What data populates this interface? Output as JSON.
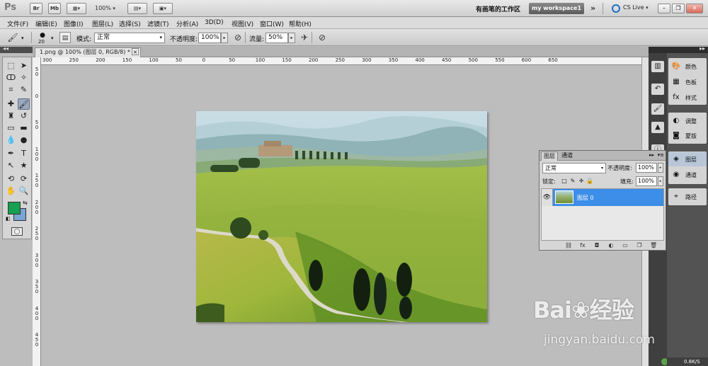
{
  "app": {
    "bridge_label": "Br",
    "minibridge_label": "Mb",
    "zoom": "100%",
    "workspace_title": "有画笔的工作区",
    "workspace_button": "my workspace1",
    "cs_live": "CS Live"
  },
  "menu": [
    "文件(F)",
    "编辑(E)",
    "图像(I)",
    "图层(L)",
    "选择(S)",
    "滤镜(T)",
    "分析(A)",
    "3D(D)",
    "视图(V)",
    "窗口(W)",
    "帮助(H)"
  ],
  "options": {
    "brush_size": "20",
    "mode_label": "模式:",
    "mode_value": "正常",
    "opacity_label": "不透明度:",
    "opacity_value": "100%",
    "flow_label": "流量:",
    "flow_value": "50%"
  },
  "document": {
    "tab_title": "1.png @ 100% (图层 0, RGB/8) *",
    "close_glyph": "×",
    "h_ruler": [
      "300",
      "250",
      "200",
      "150",
      "100",
      "50",
      "0",
      "50",
      "100",
      "150",
      "200",
      "250",
      "300",
      "350",
      "400",
      "450",
      "500",
      "550",
      "600",
      "650"
    ],
    "v_ruler": [
      "5\n0",
      "0",
      "5\n0",
      "1\n0\n0",
      "1\n5\n0",
      "2\n0\n0",
      "2\n5\n0",
      "3\n0\n0",
      "3\n5\n0",
      "4\n0\n0",
      "4\n5\n0"
    ]
  },
  "dock": {
    "items": [
      {
        "label": "颜色",
        "icon": "color-icon"
      },
      {
        "label": "色板",
        "icon": "swatches-icon"
      },
      {
        "label": "样式",
        "icon": "styles-icon"
      },
      {
        "label": "调整",
        "icon": "adjustments-icon"
      },
      {
        "label": "蒙版",
        "icon": "masks-icon"
      },
      {
        "label": "图层",
        "icon": "layers-icon"
      },
      {
        "label": "通道",
        "icon": "channels-icon"
      },
      {
        "label": "路径",
        "icon": "paths-icon"
      }
    ]
  },
  "layers_panel": {
    "tab_layers": "图层",
    "tab_channels": "通道",
    "blend_mode": "正常",
    "opacity_label": "不透明度:",
    "opacity_value": "100%",
    "lock_label": "锁定:",
    "fill_label": "填充:",
    "fill_value": "100%",
    "layers": [
      {
        "name": "图层 0",
        "visible": true,
        "selected": true
      }
    ]
  },
  "colors": {
    "foreground": "#15a150",
    "background": "#7aa3d6",
    "layer_selected": "#3c8ee8"
  },
  "watermark": {
    "logo": "Bai❀经验",
    "url": "jingyan.baidu.com"
  },
  "status": {
    "net_speed": "0.8K/S"
  }
}
